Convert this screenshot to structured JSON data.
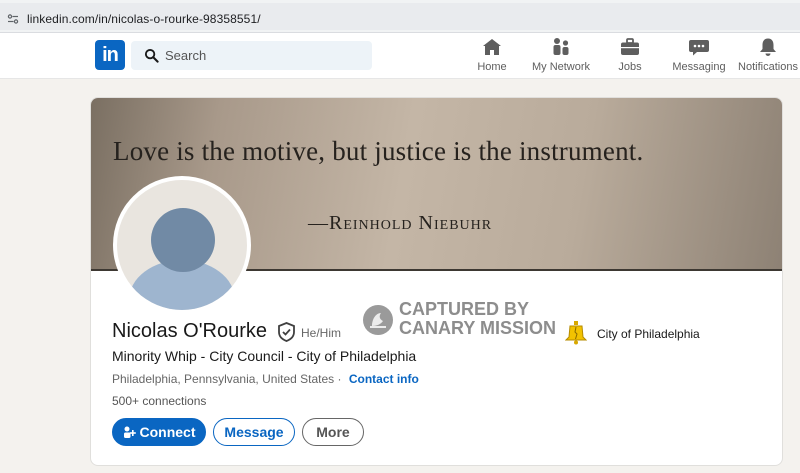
{
  "browser": {
    "url": "linkedin.com/in/nicolas-o-rourke-98358551/"
  },
  "nav": {
    "logo_text": "in",
    "search_placeholder": "Search",
    "items": [
      {
        "label": "Home",
        "icon": "home-icon"
      },
      {
        "label": "My Network",
        "icon": "network-icon"
      },
      {
        "label": "Jobs",
        "icon": "briefcase-icon"
      },
      {
        "label": "Messaging",
        "icon": "chat-icon"
      },
      {
        "label": "Notifications",
        "icon": "bell-icon"
      }
    ]
  },
  "banner": {
    "quote": "Love is the motive, but justice is the instrument.",
    "author": "—Reinhold Niebuhr"
  },
  "profile": {
    "name": "Nicolas O'Rourke",
    "pronouns": "He/Him",
    "headline": "Minority Whip - City Council - City of Philadelphia",
    "location": "Philadelphia, Pennsylvania, United States ·",
    "contact_info": "Contact info",
    "connections": "500+ connections",
    "organization": "City of Philadelphia"
  },
  "actions": {
    "connect": "Connect",
    "message": "Message",
    "more": "More"
  },
  "watermark": {
    "line1": "CAPTURED BY",
    "line2": "CANARY MISSION"
  },
  "colors": {
    "brand": "#0a66c2",
    "background": "#f4f2ee"
  }
}
